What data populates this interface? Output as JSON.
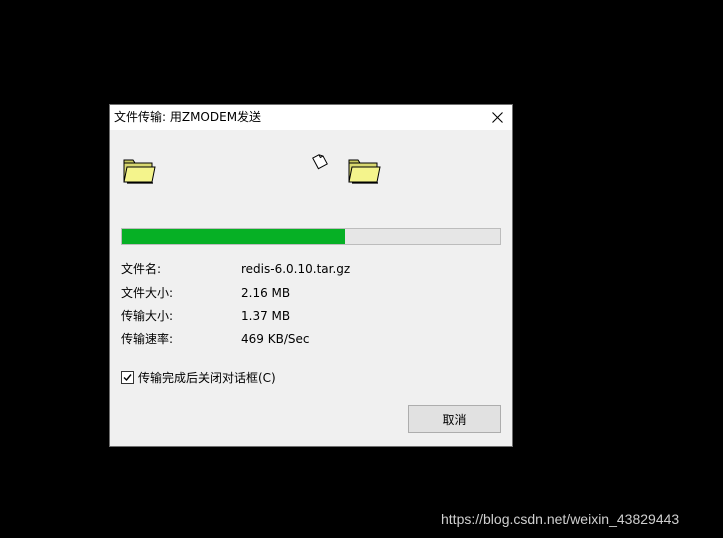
{
  "dialog": {
    "title": "文件传输: 用ZMODEM发送",
    "close_icon": "close-icon"
  },
  "transfer": {
    "progress": 0.59,
    "progress_color": "#06b025",
    "fields": [
      {
        "label": "文件名:",
        "value": "redis-6.0.10.tar.gz"
      },
      {
        "label": "文件大小:",
        "value": "2.16 MB"
      },
      {
        "label": "传输大小:",
        "value": "1.37 MB"
      },
      {
        "label": "传输速率:",
        "value": "469 KB/Sec"
      }
    ]
  },
  "icons": {
    "source": "folder-icon",
    "document": "document-icon",
    "destination": "folder-icon"
  },
  "close_after_transfer": {
    "checked": true,
    "label": "传输完成后关闭对话框(C)"
  },
  "buttons": {
    "cancel": "取消"
  },
  "watermark": "https://blog.csdn.net/weixin_43829443"
}
